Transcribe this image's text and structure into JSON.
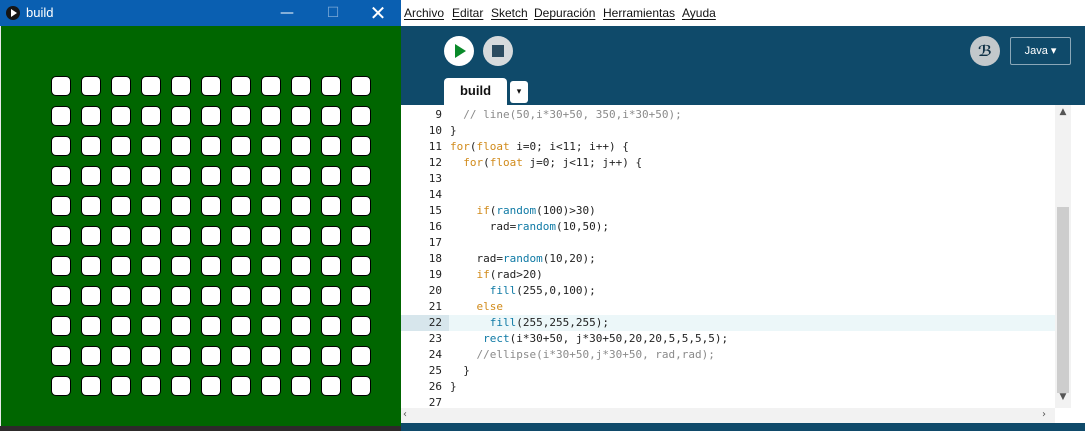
{
  "sketch_window": {
    "title": "build",
    "minimize_label": "—",
    "maximize_label": "☐",
    "close_label": "✕",
    "canvas_background": "#006600",
    "grid_rows": 11,
    "grid_cols": 11,
    "cell_fill": "#ffffff"
  },
  "ide": {
    "menu": [
      "Archivo",
      "Editar",
      "Sketch",
      "Depuración",
      "Herramientas",
      "Ayuda"
    ],
    "mode_label": "Java ▾",
    "tab_label": "build",
    "tab_menu_label": "▾",
    "debug_icon_glyph": "ℬ",
    "accent": "#0f4a6a",
    "run_color": "#0a8a2a",
    "current_line": 22,
    "code_lines": [
      {
        "n": "9",
        "html": "  <span class=\"cm\">// line(50,i*30+50, 350,i*30+50);</span>"
      },
      {
        "n": "10",
        "html": "}"
      },
      {
        "n": "11",
        "html": "<span class=\"kw\">for</span>(<span class=\"kw\">float</span> i=0; i&lt;11; i++) {"
      },
      {
        "n": "12",
        "html": "  <span class=\"kw\">for</span>(<span class=\"kw\">float</span> j=0; j&lt;11; j++) {"
      },
      {
        "n": "13",
        "html": ""
      },
      {
        "n": "14",
        "html": ""
      },
      {
        "n": "15",
        "html": "    <span class=\"kw\">if</span>(<span class=\"fn\">random</span>(100)&gt;30)"
      },
      {
        "n": "16",
        "html": "      rad=<span class=\"fn\">random</span>(10,50);"
      },
      {
        "n": "17",
        "html": ""
      },
      {
        "n": "18",
        "html": "    rad=<span class=\"fn\">random</span>(10,20);"
      },
      {
        "n": "19",
        "html": "    <span class=\"kw\">if</span>(rad&gt;20)"
      },
      {
        "n": "20",
        "html": "      <span class=\"fn\">fill</span>(255,0,100);"
      },
      {
        "n": "21",
        "html": "    <span class=\"kw\">else</span>"
      },
      {
        "n": "22",
        "html": "      <span class=\"fn\">fill</span>(255,255,255);"
      },
      {
        "n": "23",
        "html": "     <span class=\"fn\">rect</span>(i*30+50, j*30+50,20,20,5,5,5,5);"
      },
      {
        "n": "24",
        "html": "    <span class=\"cm\">//ellipse(i*30+50,j*30+50, rad,rad);</span>"
      },
      {
        "n": "25",
        "html": "  }"
      },
      {
        "n": "26",
        "html": "}"
      },
      {
        "n": "27",
        "html": ""
      }
    ]
  }
}
